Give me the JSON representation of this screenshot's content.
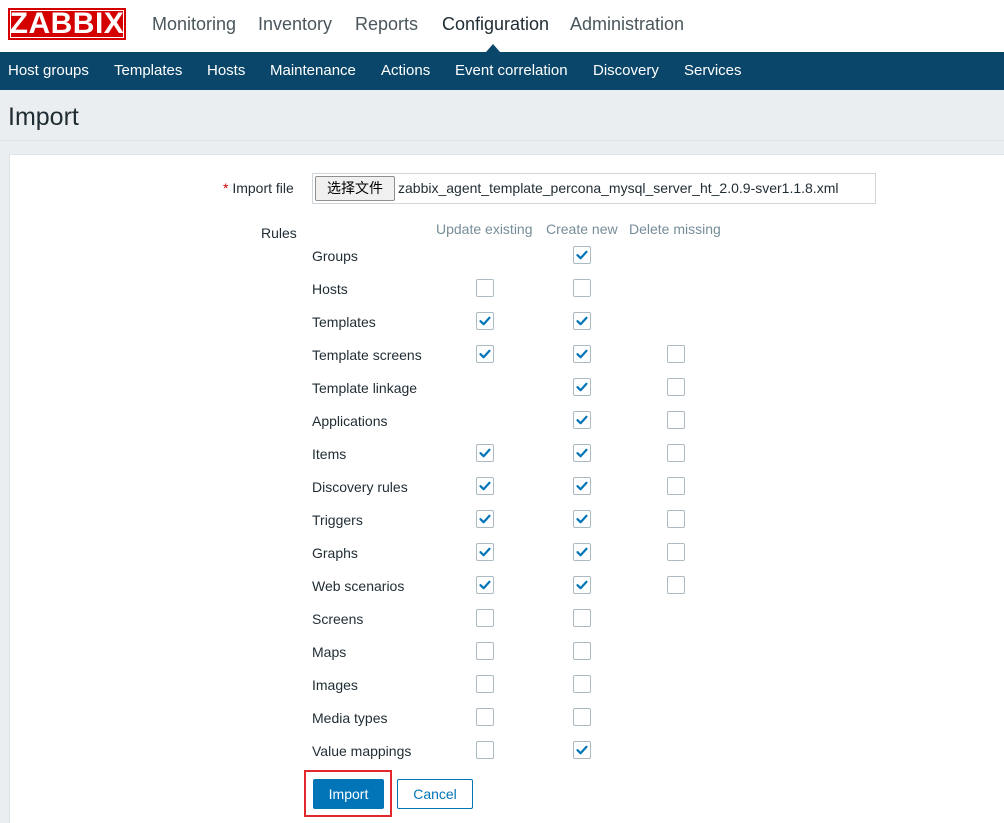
{
  "app": {
    "logo_text": "ZABBIX"
  },
  "main_menu": {
    "items": [
      {
        "label": "Monitoring"
      },
      {
        "label": "Inventory"
      },
      {
        "label": "Reports"
      },
      {
        "label": "Configuration",
        "active": true
      },
      {
        "label": "Administration"
      }
    ]
  },
  "sub_menu": {
    "items": [
      {
        "label": "Host groups"
      },
      {
        "label": "Templates"
      },
      {
        "label": "Hosts"
      },
      {
        "label": "Maintenance"
      },
      {
        "label": "Actions"
      },
      {
        "label": "Event correlation"
      },
      {
        "label": "Discovery"
      },
      {
        "label": "Services"
      }
    ]
  },
  "page": {
    "title": "Import"
  },
  "form": {
    "import_file_required_mark": "*",
    "import_file_label": "Import file",
    "file_button_label": "选择文件",
    "file_name": "zabbix_agent_template_percona_mysql_server_ht_2.0.9-sver1.1.8.xml",
    "rules_label": "Rules",
    "columns": {
      "update_existing": "Update existing",
      "create_new": "Create new",
      "delete_missing": "Delete missing"
    },
    "rules": [
      {
        "label": "Groups",
        "update": null,
        "create": true,
        "delete": null
      },
      {
        "label": "Hosts",
        "update": false,
        "create": false,
        "delete": null
      },
      {
        "label": "Templates",
        "update": true,
        "create": true,
        "delete": null
      },
      {
        "label": "Template screens",
        "update": true,
        "create": true,
        "delete": false
      },
      {
        "label": "Template linkage",
        "update": null,
        "create": true,
        "delete": false
      },
      {
        "label": "Applications",
        "update": null,
        "create": true,
        "delete": false
      },
      {
        "label": "Items",
        "update": true,
        "create": true,
        "delete": false
      },
      {
        "label": "Discovery rules",
        "update": true,
        "create": true,
        "delete": false
      },
      {
        "label": "Triggers",
        "update": true,
        "create": true,
        "delete": false
      },
      {
        "label": "Graphs",
        "update": true,
        "create": true,
        "delete": false
      },
      {
        "label": "Web scenarios",
        "update": true,
        "create": true,
        "delete": false
      },
      {
        "label": "Screens",
        "update": false,
        "create": false,
        "delete": null
      },
      {
        "label": "Maps",
        "update": false,
        "create": false,
        "delete": null
      },
      {
        "label": "Images",
        "update": false,
        "create": false,
        "delete": null
      },
      {
        "label": "Media types",
        "update": false,
        "create": false,
        "delete": null
      },
      {
        "label": "Value mappings",
        "update": false,
        "create": true,
        "delete": null
      }
    ],
    "import_button_label": "Import",
    "cancel_button_label": "Cancel"
  },
  "colors": {
    "brand_red": "#d40000",
    "nav_blue": "#0a466a",
    "accent_blue": "#0275b8",
    "highlight_red": "#e3282d"
  }
}
